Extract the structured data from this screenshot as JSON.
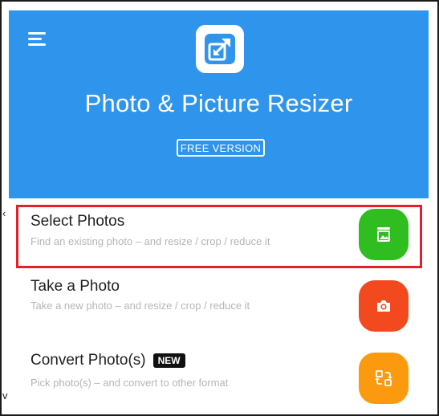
{
  "header": {
    "title": "Photo & Picture Resizer",
    "version_badge": "FREE VERSION",
    "background_color": "#2f95ec"
  },
  "icons": {
    "menu": "hamburger-menu-icon",
    "logo": "resize-arrow-icon",
    "select": "image-frame-icon",
    "take": "camera-icon",
    "convert": "convert-swap-icon"
  },
  "options": [
    {
      "title": "Select Photos",
      "subtitle": "Find an existing photo – and resize / crop / reduce it",
      "color": "#2fbd1f"
    },
    {
      "title": "Take a Photo",
      "subtitle": "Take a new photo – and resize / crop / reduce it",
      "color": "#f24a1e"
    },
    {
      "title": "Convert Photo(s)",
      "badge": "NEW",
      "subtitle": "Pick photo(s) – and convert to other format",
      "color": "#fb9a0f"
    }
  ],
  "highlight_color": "#e0222a"
}
